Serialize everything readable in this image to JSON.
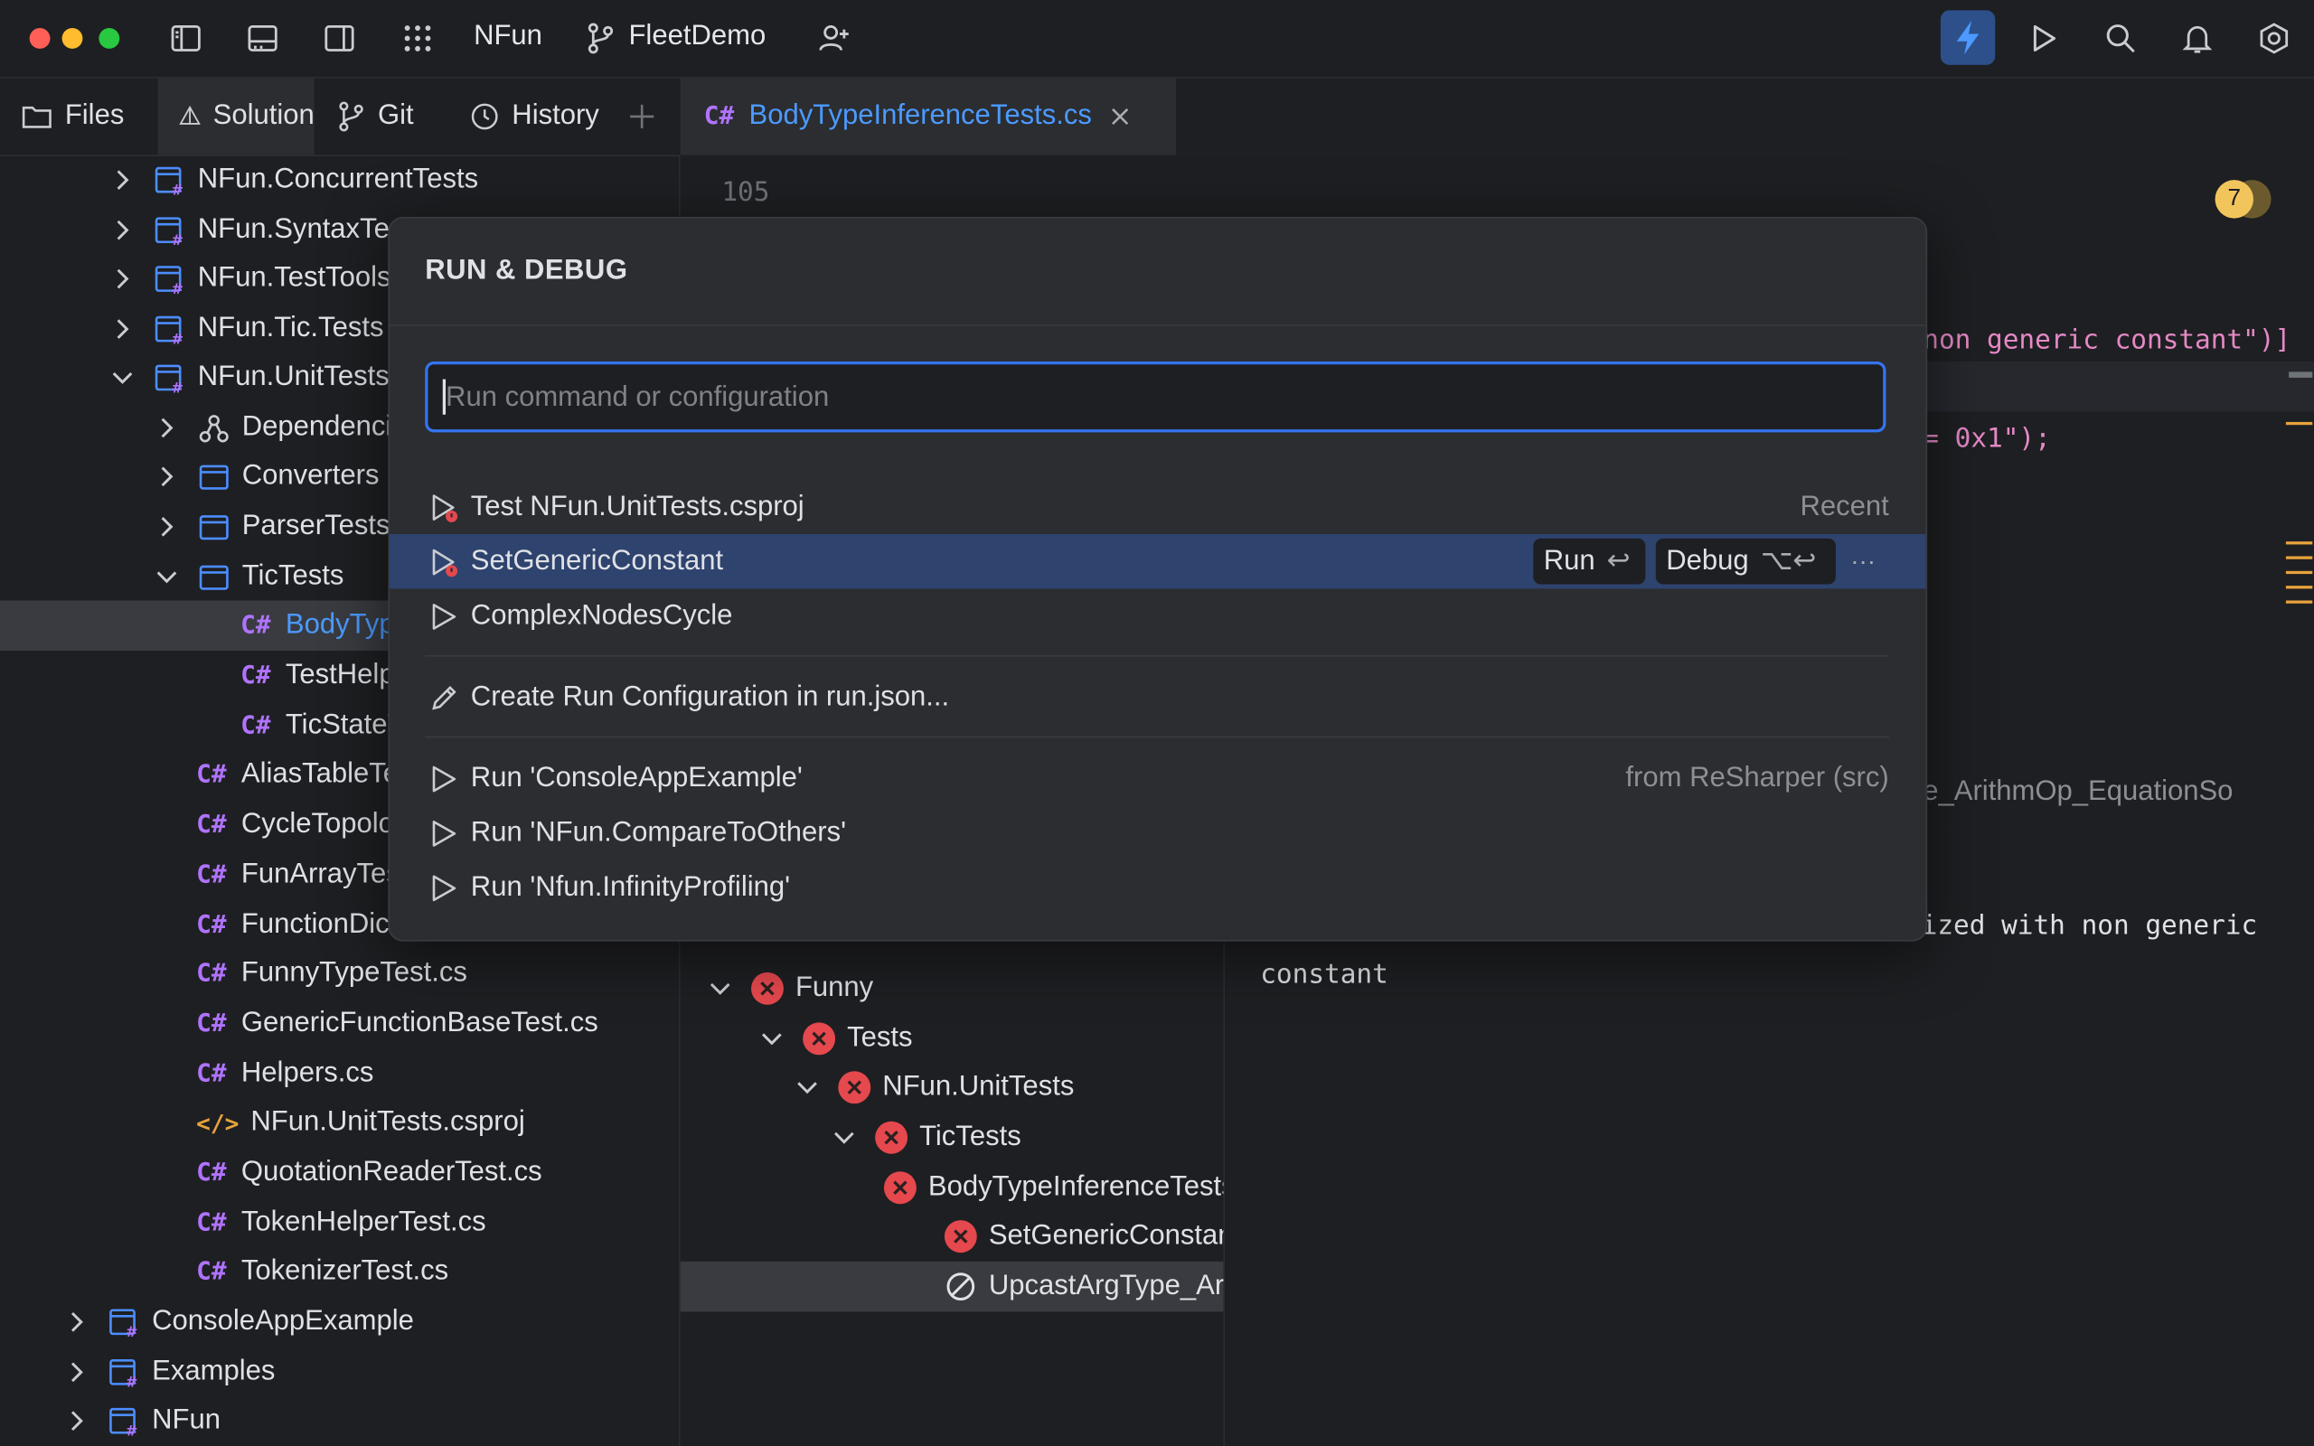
{
  "titlebar": {
    "workspace": "NFun",
    "project": "FleetDemo"
  },
  "left_tabs": [
    {
      "label": "Files"
    },
    {
      "label": "Solution"
    },
    {
      "label": "Git"
    },
    {
      "label": "History"
    }
  ],
  "tree": {
    "items": [
      {
        "label": "NFun.ConcurrentTests"
      },
      {
        "label": "NFun.SyntaxTests"
      },
      {
        "label": "NFun.TestTools"
      },
      {
        "label": "NFun.Tic.Tests"
      },
      {
        "label": "NFun.UnitTests"
      },
      {
        "label": "Dependencies"
      },
      {
        "label": "Converters"
      },
      {
        "label": "ParserTests"
      },
      {
        "label": "TicTests"
      },
      {
        "label": "BodyTypeInferenceTests.cs"
      },
      {
        "label": "TestHelper.cs"
      },
      {
        "label": "TicStateTests.cs"
      },
      {
        "label": "AliasTableTest.cs"
      },
      {
        "label": "CycleTopologyTest.cs"
      },
      {
        "label": "FunArrayTest.cs"
      },
      {
        "label": "FunctionDictionaryTest.cs"
      },
      {
        "label": "FunnyTypeTest.cs"
      },
      {
        "label": "GenericFunctionBaseTest.cs"
      },
      {
        "label": "Helpers.cs"
      },
      {
        "label": "NFun.UnitTests.csproj"
      },
      {
        "label": "QuotationReaderTest.cs"
      },
      {
        "label": "TokenHelperTest.cs"
      },
      {
        "label": "TokenizerTest.cs"
      },
      {
        "label": "ConsoleAppExample"
      },
      {
        "label": "Examples"
      },
      {
        "label": "NFun"
      }
    ],
    "cs_badge": "C#",
    "xml_badge": "</>"
  },
  "editor": {
    "tab_label": "BodyTypeInferenceTests.cs",
    "line_number": "105",
    "problems_count": "7",
    "code_fragment_1": "non generic constant\")]",
    "code_fragment_2": "= 0x1\");",
    "code_fragment_3": "e_ArithmOp_EquationSo"
  },
  "tests": {
    "items": [
      {
        "label": "Funny"
      },
      {
        "label": "Tests"
      },
      {
        "label": "NFun.UnitTests"
      },
      {
        "label": "TicTests"
      },
      {
        "label": "BodyTypeInferenceTests"
      },
      {
        "label": "SetGenericConstant"
      },
      {
        "label": "UpcastArgType_ArithmOp"
      }
    ]
  },
  "output": {
    "line1": "ized with non generic",
    "line2": "constant"
  },
  "popup": {
    "title": "RUN & DEBUG",
    "search_placeholder": "Run command or configuration",
    "items": [
      {
        "label": "Test NFun.UnitTests.csproj",
        "hint": "Recent"
      },
      {
        "label": "SetGenericConstant"
      },
      {
        "label": "ComplexNodesCycle"
      },
      {
        "label": "Create Run Configuration in run.json..."
      },
      {
        "label": "Run 'ConsoleAppExample'",
        "hint": "from ReSharper (src)"
      },
      {
        "label": "Run 'NFun.CompareToOthers'"
      },
      {
        "label": "Run 'Nfun.InfinityProfiling'"
      }
    ],
    "run_label": "Run",
    "run_key": "↩",
    "debug_label": "Debug",
    "debug_key": "⌥↩",
    "more": "···"
  },
  "colors": {
    "accent": "#3574f0",
    "selection": "#2e436e",
    "error": "#e5484d",
    "csharp": "#b073ff",
    "xml": "#e8a33c",
    "code_string": "#e589c6"
  }
}
